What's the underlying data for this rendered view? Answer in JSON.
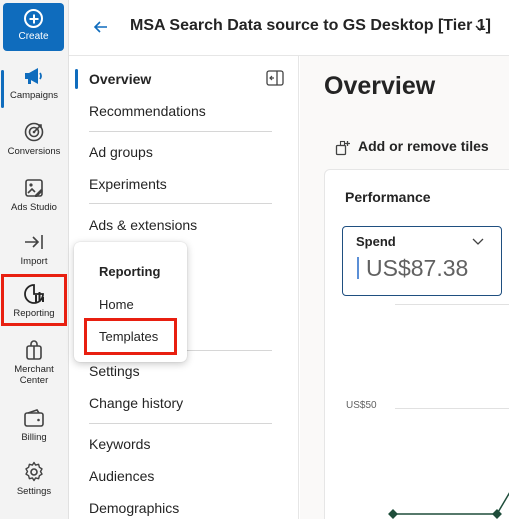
{
  "rail": {
    "create_label": "Create",
    "items": [
      {
        "id": "campaigns",
        "label": "Campaigns",
        "icon": "megaphone-icon",
        "active": true
      },
      {
        "id": "conversions",
        "label": "Conversions",
        "icon": "target-icon"
      },
      {
        "id": "ads_studio",
        "label": "Ads Studio",
        "icon": "image-edit-icon"
      },
      {
        "id": "import",
        "label": "Import",
        "icon": "import-arrow-icon"
      },
      {
        "id": "reporting",
        "label": "Reporting",
        "icon": "report-chart-icon",
        "highlighted": true
      },
      {
        "id": "merchant_center",
        "label": "Merchant Center",
        "label_line1": "Merchant",
        "label_line2": "Center",
        "icon": "shopping-bag-icon"
      },
      {
        "id": "billing",
        "label": "Billing",
        "icon": "wallet-icon"
      },
      {
        "id": "settings",
        "label": "Settings",
        "icon": "gear-icon"
      }
    ]
  },
  "header": {
    "title": "MSA Search Data source to GS Desktop [Tier 1]"
  },
  "nav": {
    "items": [
      {
        "label": "Overview",
        "selected": true
      },
      {
        "label": "Recommendations"
      },
      {
        "label": "Ad groups"
      },
      {
        "label": "Experiments"
      },
      {
        "label": "Ads & extensions"
      },
      {
        "label": "Settings"
      },
      {
        "label": "Change history"
      },
      {
        "label": "Keywords"
      },
      {
        "label": "Audiences"
      },
      {
        "label": "Demographics"
      }
    ]
  },
  "flyout": {
    "title": "Reporting",
    "items": [
      {
        "label": "Home"
      },
      {
        "label": "Templates",
        "highlighted": true
      }
    ]
  },
  "main": {
    "title": "Overview",
    "add_tiles_label": "Add or remove tiles",
    "performance": {
      "title": "Performance",
      "metric_label": "Spend",
      "metric_value": "US$87.38",
      "y_tick": "US$50"
    }
  },
  "colors": {
    "accent": "#0f6cbd",
    "highlight_red": "#e81f10",
    "chart_line": "#1e4d3a"
  }
}
